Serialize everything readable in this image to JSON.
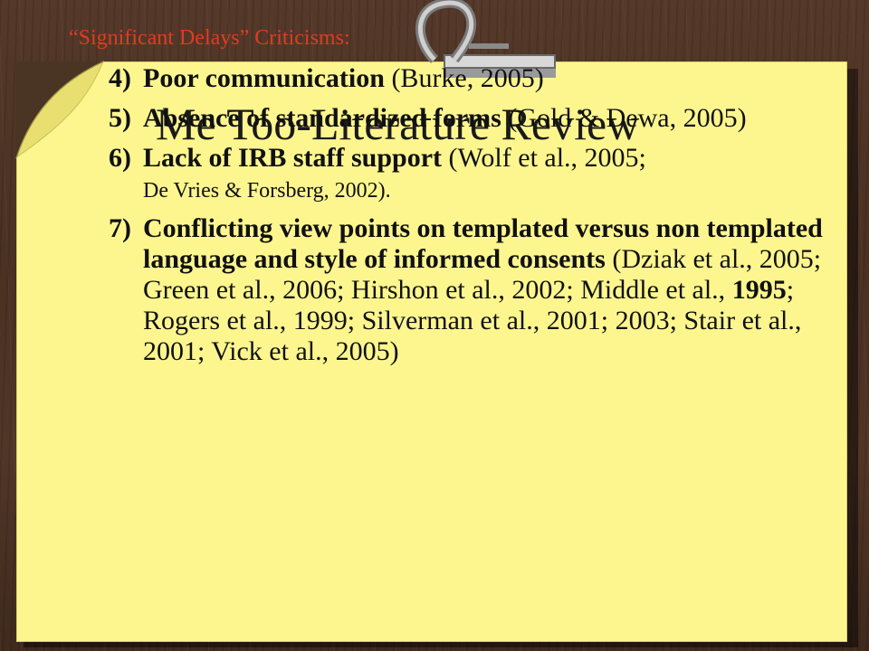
{
  "slide": {
    "title": "Me Too-Literature Review",
    "subtitle": "“Significant Delays” Criticisms:",
    "colors": {
      "subtitle": "#e03c20",
      "note": "#fdf68f",
      "wood": "#4a3424"
    },
    "icons": {
      "clip": "paper-clip-icon",
      "curl": "page-curl-icon"
    },
    "items": [
      {
        "number": "4)",
        "bold": "Poor communication",
        "rest": " (Burke, 2005)"
      },
      {
        "number": "5)",
        "bold": "Absence of standardized forms",
        "rest": " (Gold & Dewa, 2005)"
      },
      {
        "number": "6)",
        "bold": "Lack of IRB staff support",
        "rest": " (Wolf et al., 2005;",
        "rest_small": "De Vries & Forsberg, 2002)."
      },
      {
        "number": "7)",
        "bold": "Conflicting view points on templated versus non templated language and style of informed consents",
        "rest_a": " (Dziak et al., 2005; Green et al., 2006; Hirshon et al., 2002; Middle et al., ",
        "rest_bold": "1995",
        "rest_b": "; Rogers et al., 1999; Silverman et al., 2001; 2003; Stair et al., 2001; Vick et al., 2005)"
      }
    ]
  }
}
